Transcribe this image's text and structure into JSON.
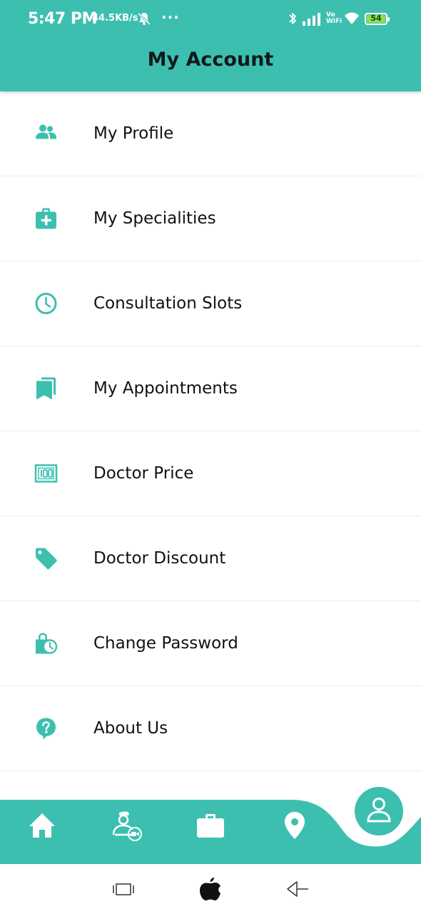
{
  "status_bar": {
    "time": "5:47 PM",
    "net_speed": "44.5KB/s",
    "more": "···",
    "vowifi_top": "Vo",
    "vowifi_bottom": "WiFi",
    "battery": "54",
    "icons": [
      "mute-icon",
      "bluetooth-icon",
      "signal-icon",
      "wifi-icon",
      "battery-icon"
    ]
  },
  "header": {
    "title": "My Account",
    "background": "#3dbfb0"
  },
  "menu": {
    "items": [
      {
        "label": "My Profile",
        "icon": "people-icon"
      },
      {
        "label": "My Specialities",
        "icon": "medical-bag-icon"
      },
      {
        "label": "Consultation Slots",
        "icon": "clock-icon"
      },
      {
        "label": "My Appointments",
        "icon": "bookmarks-icon"
      },
      {
        "label": "Doctor Price",
        "icon": "price-tag-100-icon"
      },
      {
        "label": "Doctor Discount",
        "icon": "tag-icon"
      },
      {
        "label": "Change Password",
        "icon": "lock-clock-icon"
      },
      {
        "label": "About Us",
        "icon": "help-bubble-icon"
      }
    ]
  },
  "bottom_nav": {
    "items": [
      "home-icon",
      "doctor-video-call-icon",
      "briefcase-icon",
      "location-pin-icon"
    ],
    "active": "profile-icon",
    "accent": "#3dbfb0"
  },
  "system_nav": {
    "buttons": [
      "recent-apps-icon",
      "apple-logo-icon",
      "back-icon"
    ]
  }
}
